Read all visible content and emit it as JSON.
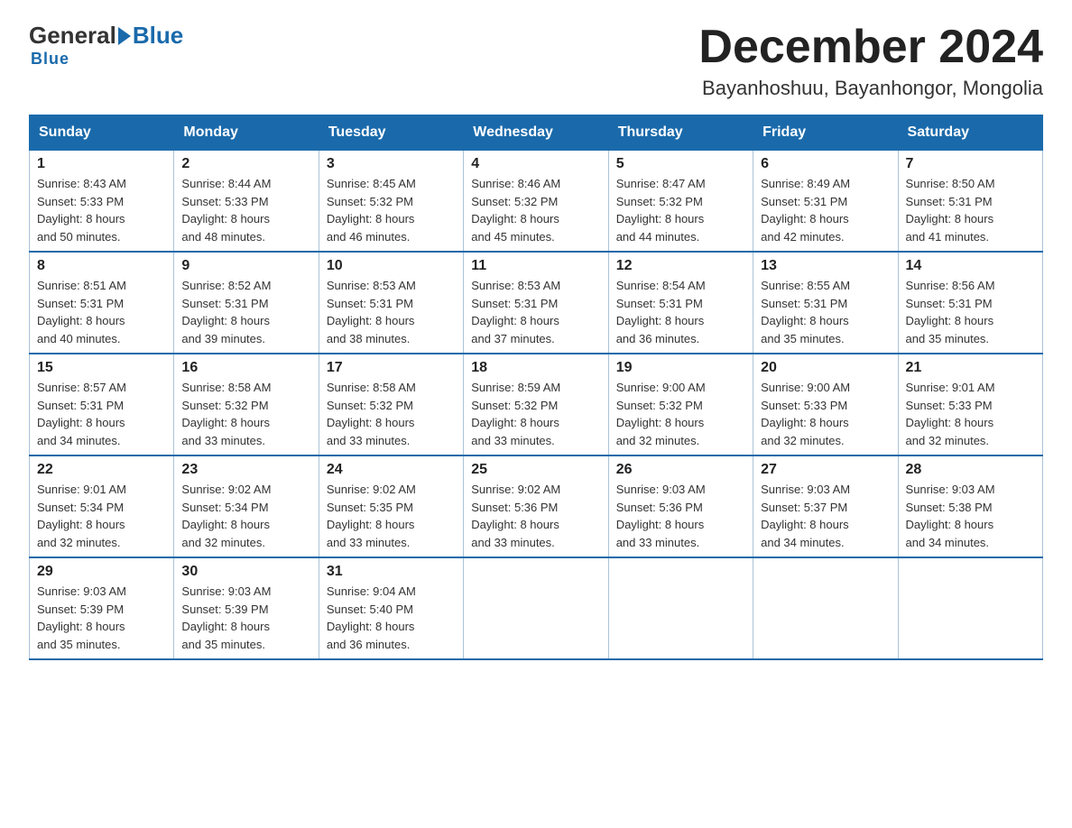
{
  "header": {
    "logo_general": "General",
    "logo_blue": "Blue",
    "title": "December 2024",
    "subtitle": "Bayanhoshuu, Bayanhongor, Mongolia"
  },
  "days_of_week": [
    "Sunday",
    "Monday",
    "Tuesday",
    "Wednesday",
    "Thursday",
    "Friday",
    "Saturday"
  ],
  "weeks": [
    [
      {
        "day": "1",
        "sunrise": "8:43 AM",
        "sunset": "5:33 PM",
        "daylight": "8 hours and 50 minutes."
      },
      {
        "day": "2",
        "sunrise": "8:44 AM",
        "sunset": "5:33 PM",
        "daylight": "8 hours and 48 minutes."
      },
      {
        "day": "3",
        "sunrise": "8:45 AM",
        "sunset": "5:32 PM",
        "daylight": "8 hours and 46 minutes."
      },
      {
        "day": "4",
        "sunrise": "8:46 AM",
        "sunset": "5:32 PM",
        "daylight": "8 hours and 45 minutes."
      },
      {
        "day": "5",
        "sunrise": "8:47 AM",
        "sunset": "5:32 PM",
        "daylight": "8 hours and 44 minutes."
      },
      {
        "day": "6",
        "sunrise": "8:49 AM",
        "sunset": "5:31 PM",
        "daylight": "8 hours and 42 minutes."
      },
      {
        "day": "7",
        "sunrise": "8:50 AM",
        "sunset": "5:31 PM",
        "daylight": "8 hours and 41 minutes."
      }
    ],
    [
      {
        "day": "8",
        "sunrise": "8:51 AM",
        "sunset": "5:31 PM",
        "daylight": "8 hours and 40 minutes."
      },
      {
        "day": "9",
        "sunrise": "8:52 AM",
        "sunset": "5:31 PM",
        "daylight": "8 hours and 39 minutes."
      },
      {
        "day": "10",
        "sunrise": "8:53 AM",
        "sunset": "5:31 PM",
        "daylight": "8 hours and 38 minutes."
      },
      {
        "day": "11",
        "sunrise": "8:53 AM",
        "sunset": "5:31 PM",
        "daylight": "8 hours and 37 minutes."
      },
      {
        "day": "12",
        "sunrise": "8:54 AM",
        "sunset": "5:31 PM",
        "daylight": "8 hours and 36 minutes."
      },
      {
        "day": "13",
        "sunrise": "8:55 AM",
        "sunset": "5:31 PM",
        "daylight": "8 hours and 35 minutes."
      },
      {
        "day": "14",
        "sunrise": "8:56 AM",
        "sunset": "5:31 PM",
        "daylight": "8 hours and 35 minutes."
      }
    ],
    [
      {
        "day": "15",
        "sunrise": "8:57 AM",
        "sunset": "5:31 PM",
        "daylight": "8 hours and 34 minutes."
      },
      {
        "day": "16",
        "sunrise": "8:58 AM",
        "sunset": "5:32 PM",
        "daylight": "8 hours and 33 minutes."
      },
      {
        "day": "17",
        "sunrise": "8:58 AM",
        "sunset": "5:32 PM",
        "daylight": "8 hours and 33 minutes."
      },
      {
        "day": "18",
        "sunrise": "8:59 AM",
        "sunset": "5:32 PM",
        "daylight": "8 hours and 33 minutes."
      },
      {
        "day": "19",
        "sunrise": "9:00 AM",
        "sunset": "5:32 PM",
        "daylight": "8 hours and 32 minutes."
      },
      {
        "day": "20",
        "sunrise": "9:00 AM",
        "sunset": "5:33 PM",
        "daylight": "8 hours and 32 minutes."
      },
      {
        "day": "21",
        "sunrise": "9:01 AM",
        "sunset": "5:33 PM",
        "daylight": "8 hours and 32 minutes."
      }
    ],
    [
      {
        "day": "22",
        "sunrise": "9:01 AM",
        "sunset": "5:34 PM",
        "daylight": "8 hours and 32 minutes."
      },
      {
        "day": "23",
        "sunrise": "9:02 AM",
        "sunset": "5:34 PM",
        "daylight": "8 hours and 32 minutes."
      },
      {
        "day": "24",
        "sunrise": "9:02 AM",
        "sunset": "5:35 PM",
        "daylight": "8 hours and 33 minutes."
      },
      {
        "day": "25",
        "sunrise": "9:02 AM",
        "sunset": "5:36 PM",
        "daylight": "8 hours and 33 minutes."
      },
      {
        "day": "26",
        "sunrise": "9:03 AM",
        "sunset": "5:36 PM",
        "daylight": "8 hours and 33 minutes."
      },
      {
        "day": "27",
        "sunrise": "9:03 AM",
        "sunset": "5:37 PM",
        "daylight": "8 hours and 34 minutes."
      },
      {
        "day": "28",
        "sunrise": "9:03 AM",
        "sunset": "5:38 PM",
        "daylight": "8 hours and 34 minutes."
      }
    ],
    [
      {
        "day": "29",
        "sunrise": "9:03 AM",
        "sunset": "5:39 PM",
        "daylight": "8 hours and 35 minutes."
      },
      {
        "day": "30",
        "sunrise": "9:03 AM",
        "sunset": "5:39 PM",
        "daylight": "8 hours and 35 minutes."
      },
      {
        "day": "31",
        "sunrise": "9:04 AM",
        "sunset": "5:40 PM",
        "daylight": "8 hours and 36 minutes."
      },
      null,
      null,
      null,
      null
    ]
  ],
  "labels": {
    "sunrise": "Sunrise:",
    "sunset": "Sunset:",
    "daylight": "Daylight:"
  }
}
